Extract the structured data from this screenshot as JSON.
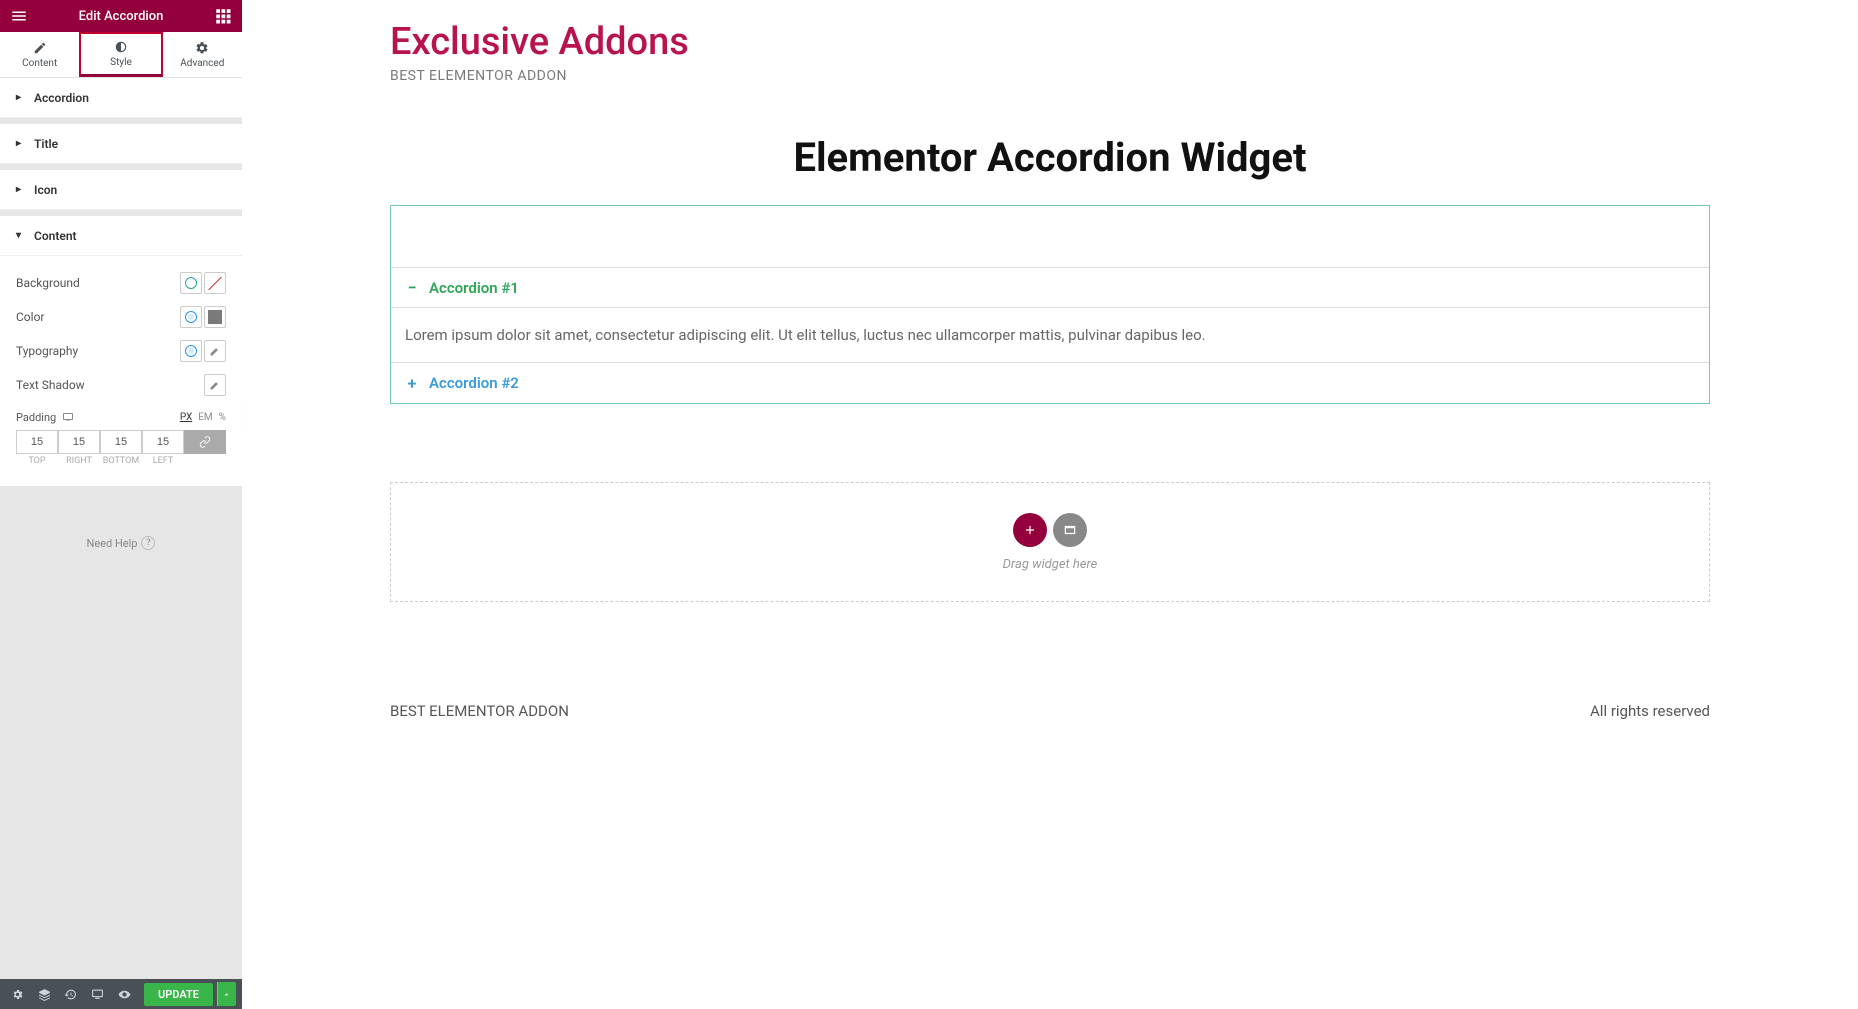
{
  "header": {
    "title": "Edit Accordion"
  },
  "tabs": {
    "content": "Content",
    "style": "Style",
    "advanced": "Advanced"
  },
  "sections": {
    "accordion": "Accordion",
    "title": "Title",
    "icon": "Icon",
    "content": "Content"
  },
  "controls": {
    "background": "Background",
    "color": "Color",
    "typography": "Typography",
    "text_shadow": "Text Shadow",
    "padding": "Padding",
    "units": {
      "px": "PX",
      "em": "EM",
      "pct": "%"
    },
    "padding_values": {
      "top": "15",
      "right": "15",
      "bottom": "15",
      "left": "15"
    },
    "padding_labels": {
      "top": "TOP",
      "right": "RIGHT",
      "bottom": "BOTTOM",
      "left": "LEFT"
    }
  },
  "need_help": "Need Help",
  "footer_button": "UPDATE",
  "canvas": {
    "brand": "Exclusive Addons",
    "brand_sub": "BEST ELEMENTOR ADDON",
    "widget_title": "Elementor Accordion Widget",
    "accordion": {
      "item1": "Accordion #1",
      "item1_content": "Lorem ipsum dolor sit amet, consectetur adipiscing elit. Ut elit tellus, luctus nec ullamcorper mattis, pulvinar dapibus leo.",
      "item2": "Accordion #2"
    },
    "drop_text": "Drag widget here",
    "footer_left": "BEST ELEMENTOR ADDON",
    "footer_right": "All rights reserved"
  }
}
